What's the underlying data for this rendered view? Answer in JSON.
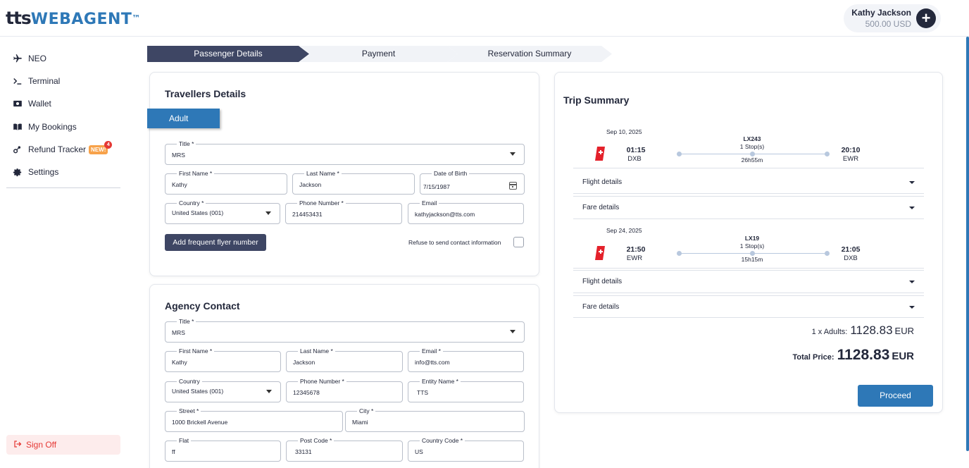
{
  "header": {
    "logo_tts": "tts",
    "logo_webagent": "WEBAGENT",
    "logo_tm": "™",
    "user_name": "Kathy Jackson",
    "user_balance": "500.00 USD",
    "add_icon": "plus-icon"
  },
  "sidebar": {
    "items": [
      {
        "label": "NEO",
        "icon": "plane-icon"
      },
      {
        "label": "Terminal",
        "icon": "terminal-icon"
      },
      {
        "label": "Wallet",
        "icon": "wallet-icon"
      },
      {
        "label": "My Bookings",
        "icon": "book-icon"
      },
      {
        "label": "Refund Tracker",
        "icon": "refund-icon",
        "badge": "NEW!",
        "badge_count": "4"
      },
      {
        "label": "Settings",
        "icon": "gear-icon"
      }
    ],
    "sign_off": "Sign Off"
  },
  "stepper": {
    "steps": [
      "Passenger Details",
      "Payment",
      "Reservation Summary"
    ],
    "active_index": 0
  },
  "travellers": {
    "title": "Travellers Details",
    "tab_label": "Adult",
    "title_field": {
      "label": "Title *",
      "value": "MRS"
    },
    "first_name": {
      "label": "First Name *",
      "value": "Kathy"
    },
    "last_name": {
      "label": "Last Name *",
      "value": "Jackson"
    },
    "dob": {
      "label": "Date of Birth",
      "value": "7/15/1987"
    },
    "country": {
      "label": "Country *",
      "value": "United States (001)"
    },
    "phone": {
      "label": "Phone Number *",
      "value": "214453431"
    },
    "email": {
      "label": "Email",
      "value": "kathyjackson@tts.com"
    },
    "add_ffn_button": "Add frequent flyer number",
    "refuse_label": "Refuse to send contact information"
  },
  "agency": {
    "title": "Agency Contact",
    "title_field": {
      "label": "Title *",
      "value": "MRS"
    },
    "first_name": {
      "label": "First Name *",
      "value": "Kathy"
    },
    "last_name": {
      "label": "Last Name *",
      "value": "Jackson"
    },
    "email": {
      "label": "Email *",
      "value": "info@tts.com"
    },
    "country": {
      "label": "Country",
      "value": "United States (001)"
    },
    "phone": {
      "label": "Phone Number *",
      "value": "12345678"
    },
    "entity": {
      "label": "Entity Name *",
      "value": "TTS"
    },
    "street": {
      "label": "Street *",
      "value": "1000 Brickell  Avenue"
    },
    "city": {
      "label": "City *",
      "value": "Miami"
    },
    "flat": {
      "label": "Flat",
      "value": "ff"
    },
    "post_code": {
      "label": "Post Code *",
      "value": "33131"
    },
    "country_code": {
      "label": "Country Code *",
      "value": "US"
    }
  },
  "trip": {
    "title": "Trip Summary",
    "segments": [
      {
        "date": "Sep 10, 2025",
        "dep_time": "01:15",
        "dep_code": "DXB",
        "flight": "LX243",
        "stops": "1 Stop(s)",
        "duration": "26h55m",
        "arr_time": "20:10",
        "arr_code": "EWR",
        "airline_icon": "swiss-airline-icon"
      },
      {
        "date": "Sep 24, 2025",
        "dep_time": "21:50",
        "dep_code": "EWR",
        "flight": "LX19",
        "stops": "1 Stop(s)",
        "duration": "15h15m",
        "arr_time": "21:05",
        "arr_code": "DXB",
        "airline_icon": "swiss-airline-icon"
      }
    ],
    "flight_details": "Flight details",
    "fare_details": "Fare details",
    "adults_label": "1 x Adults:",
    "adults_amount": "1128.83",
    "adults_currency": "EUR",
    "total_label": "Total Price:",
    "total_amount": "1128.83",
    "total_currency": "EUR",
    "proceed_button": "Proceed"
  },
  "colors": {
    "brand_dark": "#23283b",
    "brand_blue": "#2e78b7",
    "stepper_active": "#3e4664",
    "sign_off_red": "#e53935"
  }
}
